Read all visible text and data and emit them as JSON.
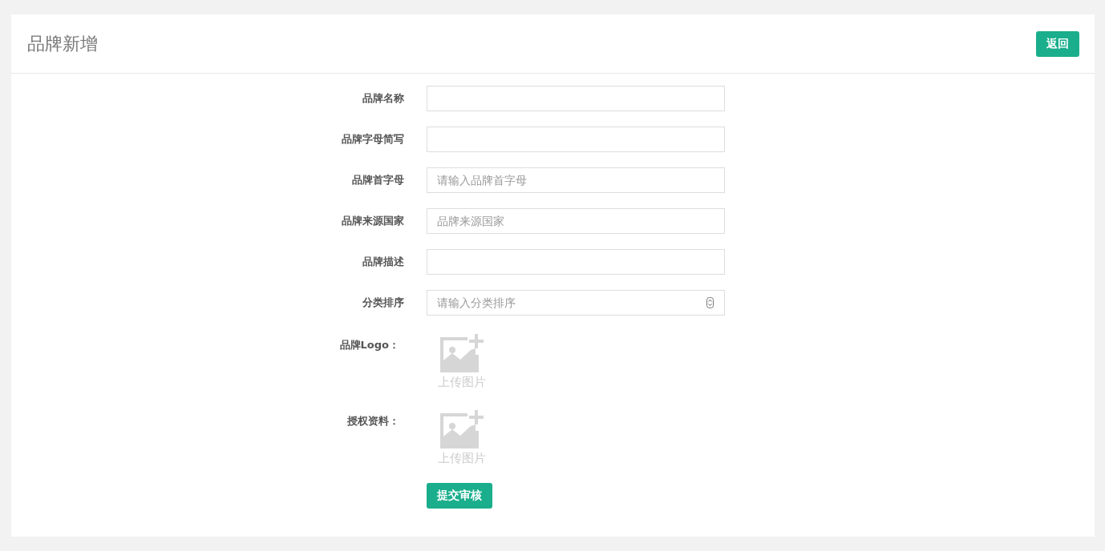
{
  "header": {
    "title": "品牌新增",
    "back_button": "返回"
  },
  "fields": [
    {
      "label": "品牌名称",
      "kind": "text"
    },
    {
      "label": "品牌字母简写",
      "kind": "text"
    },
    {
      "label": "品牌首字母",
      "kind": "text",
      "placeholder": "请输入品牌首字母"
    },
    {
      "label": "品牌来源国家",
      "kind": "text",
      "placeholder": "品牌来源国家"
    },
    {
      "label": "品牌描述",
      "kind": "text"
    },
    {
      "label": "分类排序",
      "kind": "number",
      "placeholder": "请输入分类排序"
    }
  ],
  "uploads": [
    {
      "label": "品牌Logo：",
      "button": "上传图片"
    },
    {
      "label": "授权资料：",
      "button": "上传图片"
    }
  ],
  "submit_button": "提交审核"
}
